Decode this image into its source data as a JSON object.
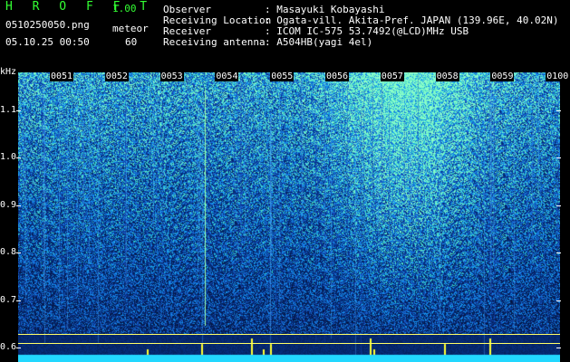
{
  "header": {
    "logo_text": "H R O F F T",
    "version": "1.00",
    "filename": "0510250050.png",
    "mode_label": "meteor",
    "datetime": "05.10.25 00:50",
    "count": "60",
    "labels": {
      "observer": "Observer",
      "location": "Receiving Location",
      "receiver": "Receiver",
      "antenna": "Receiving antenna"
    },
    "values": {
      "observer": ": Masayuki Kobayashi",
      "location": ": Ogata-vill. Akita-Pref. JAPAN (139.96E, 40.02N)",
      "receiver": ": ICOM IC-575 53.7492(@LCD)MHz USB",
      "antenna": ": A504HB(yagi 4el)"
    }
  },
  "axis": {
    "unit": "kHz",
    "y_ticks": [
      "1.1",
      "1.0",
      "0.9",
      "0.8",
      "0.7",
      "0.6"
    ],
    "y_range": [
      0.57,
      1.18
    ],
    "x_ticks": [
      "0051",
      "0052",
      "0053",
      "0054",
      "0055",
      "0056",
      "0057",
      "0058",
      "0059",
      "0100"
    ]
  },
  "colors": {
    "background": "#000000",
    "header_green": "#33ff33",
    "signal_low": "#0a1a6e",
    "signal_mid": "#2a6cff",
    "signal_high": "#6cffd0",
    "meteor": "#ffff33",
    "baseline": "#22d8ff"
  }
}
